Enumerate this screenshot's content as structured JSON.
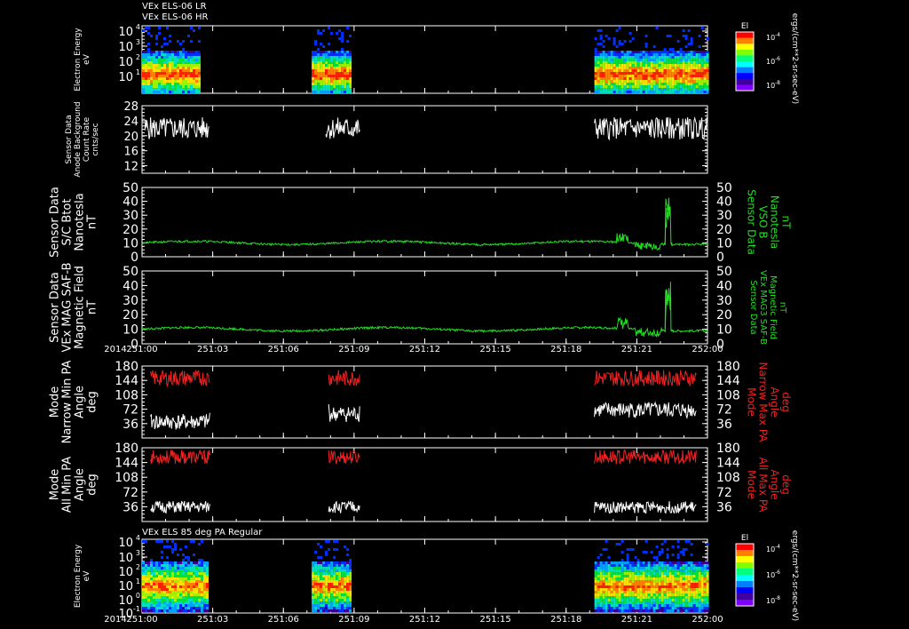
{
  "colors": {
    "background": "#000000",
    "axis": "#ffffff",
    "trace_white": "#ffffff",
    "trace_green": "#22dd22",
    "trace_red": "#ee2222"
  },
  "time_axis": {
    "year": "2014",
    "ticks": [
      "251:00",
      "251:03",
      "251:06",
      "251:09",
      "251:12",
      "251:15",
      "251:18",
      "251:21",
      "252:00"
    ]
  },
  "chart_data": [
    {
      "type": "heatmap",
      "title_lines": [
        "VEx ELS-06 LR",
        "VEx ELS-06 HR"
      ],
      "ylabel_lines": [
        "Electron Energy",
        "eV"
      ],
      "yticks": [
        "10",
        "10",
        "10",
        "10"
      ],
      "ytick_exp": [
        "1",
        "2",
        "3",
        "4"
      ],
      "colorbar": {
        "label": "El",
        "ticks": [
          "10",
          "10",
          "10"
        ],
        "tick_exp": [
          "-4",
          "-6",
          "-8"
        ]
      },
      "units": "ergs/(cm**2-sr-sec-eV)",
      "data_intervals": [
        [
          0.0,
          0.1
        ],
        [
          0.3,
          0.37
        ],
        [
          0.8,
          1.0
        ]
      ]
    },
    {
      "type": "line",
      "ylabel_lines": [
        "Sensor Data",
        "Anode Background",
        "Count Rate",
        "cnts/sec"
      ],
      "yticks": [
        "28",
        "24",
        "20",
        "16",
        "12"
      ],
      "ylim": [
        10,
        28
      ],
      "series": [
        {
          "color": "#ffffff"
        }
      ]
    },
    {
      "type": "line",
      "ylabel_lines": [
        "Sensor Data",
        "S/C Btot",
        "Nanotesla",
        "nT"
      ],
      "right_label_lines": [
        "Sensor Data",
        "VSO B",
        "Nanotesla",
        "nT"
      ],
      "yticks": [
        "50",
        "40",
        "30",
        "20",
        "10",
        "0"
      ],
      "ylim": [
        0,
        50
      ],
      "series": [
        {
          "color": "#22dd22"
        }
      ]
    },
    {
      "type": "line",
      "ylabel_lines": [
        "Sensor Data",
        "VEx MAG SAF-B",
        "Magnetic Field",
        "nT"
      ],
      "right_label_lines": [
        "Sensor Data",
        "VEx MAG3 SAF-B",
        "Magnetic Field",
        "nT"
      ],
      "yticks": [
        "50",
        "40",
        "30",
        "20",
        "10",
        "0"
      ],
      "ylim": [
        0,
        50
      ],
      "series": [
        {
          "color": "#22dd22"
        }
      ]
    },
    {
      "type": "line",
      "ylabel_lines": [
        "Mode",
        "Narrow Min PA",
        "Angle",
        "deg"
      ],
      "right_label_lines": [
        "Mode",
        "Narrow Max PA",
        "Angle",
        "deg"
      ],
      "yticks": [
        "180",
        "144",
        "108",
        "72",
        "36"
      ],
      "ylim": [
        0,
        180
      ],
      "series": [
        {
          "color": "#ffffff"
        },
        {
          "color": "#ee2222"
        }
      ]
    },
    {
      "type": "line",
      "ylabel_lines": [
        "Mode",
        "All Min PA",
        "Angle",
        "deg"
      ],
      "right_label_lines": [
        "Mode",
        "All Max PA",
        "Angle",
        "deg"
      ],
      "yticks": [
        "180",
        "144",
        "108",
        "72",
        "36"
      ],
      "ylim": [
        0,
        180
      ],
      "series": [
        {
          "color": "#ffffff"
        },
        {
          "color": "#ee2222"
        }
      ]
    },
    {
      "type": "heatmap",
      "title_lines": [
        "VEx ELS 85 deg PA Regular"
      ],
      "ylabel_lines": [
        "Electron Energy",
        "eV"
      ],
      "yticks": [
        "10",
        "10",
        "10",
        "10",
        "10",
        "10"
      ],
      "ytick_exp": [
        "4",
        "3",
        "2",
        "1",
        "0",
        "-1"
      ],
      "colorbar": {
        "label": "El",
        "ticks": [
          "10",
          "10",
          "10"
        ],
        "tick_exp": [
          "-4",
          "-6",
          "-8"
        ]
      },
      "units": "ergs/(cm**2-sr-sec-eV)",
      "data_intervals": [
        [
          0.0,
          0.115
        ],
        [
          0.3,
          0.37
        ],
        [
          0.8,
          1.0
        ]
      ]
    }
  ]
}
